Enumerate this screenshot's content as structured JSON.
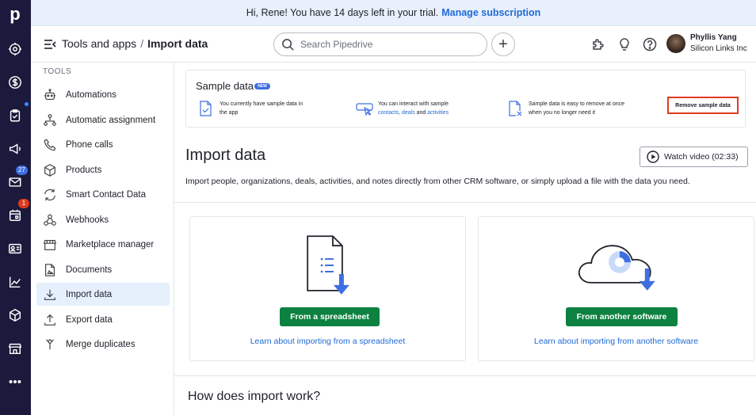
{
  "rail": {
    "logo": "p",
    "badges": {
      "mail": "27",
      "calendar": "1"
    }
  },
  "banner": {
    "text": "Hi, Rene! You have 14 days left in your trial.",
    "link": "Manage subscription"
  },
  "header": {
    "breadcrumb_parent": "Tools and apps",
    "breadcrumb_sep": "/",
    "breadcrumb_current": "Import data",
    "search_placeholder": "Search Pipedrive",
    "user_name": "Phyllis Yang",
    "user_company": "Silicon Links Inc"
  },
  "sidebar": {
    "section": "TOOLS",
    "items": [
      {
        "label": "Automations",
        "icon": "robot-icon"
      },
      {
        "label": "Automatic assignment",
        "icon": "assignment-icon"
      },
      {
        "label": "Phone calls",
        "icon": "phone-icon"
      },
      {
        "label": "Products",
        "icon": "box-icon"
      },
      {
        "label": "Smart Contact Data",
        "icon": "refresh-icon"
      },
      {
        "label": "Webhooks",
        "icon": "webhook-icon"
      },
      {
        "label": "Marketplace manager",
        "icon": "store-icon"
      },
      {
        "label": "Documents",
        "icon": "document-icon"
      },
      {
        "label": "Import data",
        "icon": "import-icon"
      },
      {
        "label": "Export data",
        "icon": "export-icon"
      },
      {
        "label": "Merge duplicates",
        "icon": "merge-icon"
      }
    ],
    "active_index": 8
  },
  "sample": {
    "title": "Sample data",
    "badge": "NEW",
    "feature1_line1": "You currently have sample data in",
    "feature1_line2": "the app",
    "feature2_line1": "You can interact with sample",
    "feature2_link1": "contacts",
    "feature2_sep1": ", ",
    "feature2_link2": "deals",
    "feature2_and": " and ",
    "feature2_link3": "activities",
    "feature3_line1": "Sample data is easy to remove at once",
    "feature3_line2": "when you no longer need it",
    "remove_button": "Remove sample data"
  },
  "main": {
    "title": "Import data",
    "watch_button": "Watch video (02:33)",
    "description": "Import people, organizations, deals, activities, and notes directly from other CRM software, or simply upload a file with the data you need.",
    "cards": [
      {
        "button": "From a spreadsheet",
        "link": "Learn about importing from a spreadsheet"
      },
      {
        "button": "From another software",
        "link": "Learn about importing from another software"
      }
    ],
    "how_title": "How does import work?"
  },
  "colors": {
    "rail": "#1c1a3c",
    "accent_blue": "#1e6bd6",
    "primary_green": "#0d8140",
    "highlight_red": "#e03a1e",
    "active_item": "#e6f0fc"
  }
}
